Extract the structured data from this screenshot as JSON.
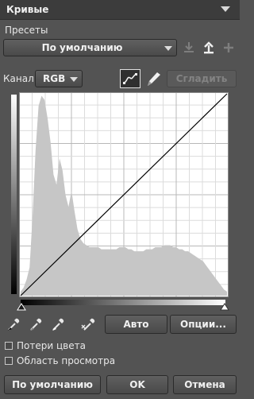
{
  "panel": {
    "title": "Кривые"
  },
  "presets": {
    "label": "Пресеты",
    "selected": "По умолчанию"
  },
  "channel": {
    "label": "Канал",
    "selected": "RGB",
    "smooth_label": "Сгладить"
  },
  "eyedroppers": [
    "black-point",
    "gray-point",
    "white-point",
    "target-adjust"
  ],
  "buttons": {
    "auto": "Авто",
    "options": "Опции...",
    "defaults": "По умолчанию",
    "ok": "OK",
    "cancel": "Отмена"
  },
  "checkboxes": {
    "clipping": "Потери цвета",
    "preview_area": "Область просмотра"
  },
  "histogram": [
    2,
    4,
    8,
    14,
    40,
    72,
    94,
    99,
    97,
    88,
    76,
    60,
    55,
    68,
    62,
    50,
    44,
    52,
    42,
    33,
    28,
    26,
    25,
    24,
    24,
    24,
    24,
    23,
    23,
    23,
    23,
    23,
    23,
    24,
    24,
    24,
    23,
    23,
    22,
    22,
    22,
    22,
    23,
    23,
    23,
    24,
    24,
    24,
    25,
    25,
    25,
    24,
    24,
    23,
    23,
    22,
    22,
    21,
    20,
    19,
    18,
    17,
    15,
    13,
    11,
    9,
    7,
    5,
    3,
    2
  ]
}
